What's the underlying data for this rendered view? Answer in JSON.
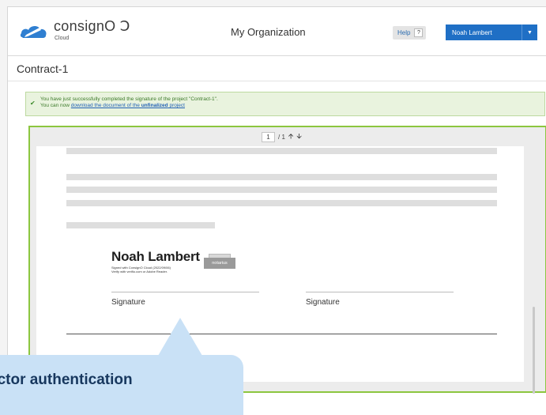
{
  "header": {
    "logo_text": "consignO Ↄ",
    "logo_sub": "Cloud",
    "org_title": "My Organization",
    "help_label": "Help",
    "help_icon": "?",
    "user_name": "Noah Lambert",
    "user_caret": "▼"
  },
  "page": {
    "title": "Contract-1"
  },
  "alert": {
    "line1": "You have just successfully completed the signature of the project \"Contract-1\".",
    "line2_prefix": "You can now ",
    "link_text": "download the document of the ",
    "link_bold": "unfinalized",
    "link_suffix": " project"
  },
  "viewer": {
    "current_page": "1",
    "total_pages": "/ 1",
    "up_arrow": "🡩",
    "down_arrow": "🡫"
  },
  "document": {
    "signer_name": "Noah Lambert",
    "signed_with": "Signed with ConsignO Cloud (2022/09/06)",
    "verify_with": "Verify with verifio.com or Adobe Reader.",
    "stamp": "notarius",
    "signature_label_1": "Signature",
    "signature_label_2": "Signature"
  },
  "callout": {
    "text": "actor authentication"
  },
  "colors": {
    "accent_blue": "#1f6fc5",
    "viewer_border": "#8cc63f",
    "alert_bg": "#e9f3de",
    "callout_bg": "#c9e1f6"
  }
}
